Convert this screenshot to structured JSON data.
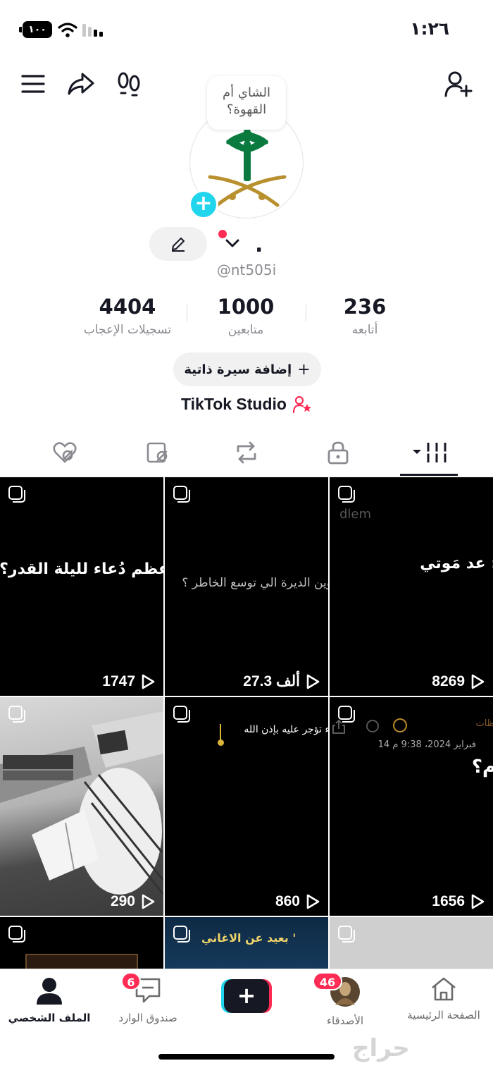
{
  "status_bar": {
    "battery": "١٠٠",
    "time": "١:٢٦"
  },
  "profile": {
    "note_bubble": "الشاي أم القهوة؟",
    "display_name": ".",
    "handle": "@nt505i"
  },
  "stats": [
    {
      "value": "4404",
      "label": "تسجيلات الإعجاب"
    },
    {
      "value": "1000",
      "label": "متابعين"
    },
    {
      "value": "236",
      "label": "أتابعه"
    }
  ],
  "bio_button": {
    "label": "إضافة سيرة ذاتية",
    "plus": "+"
  },
  "studio_link": "TikTok Studio",
  "videos": [
    {
      "caption": "عظم دُعاء لليلة القدر؟",
      "views": "1747"
    },
    {
      "caption": "وين الديرة الي توسع الخاطر ؟",
      "views": "27.3 ألف"
    },
    {
      "caption": "عد مَوتي :",
      "overlay": "dlem",
      "views": "8269"
    },
    {
      "caption": "",
      "views": "290"
    },
    {
      "caption": "ء تؤجر عليه بإذن الله",
      "views": "860"
    },
    {
      "caption": "م؟",
      "overlay": "14 فبراير 2024، 9:38 م",
      "overlay2": "ظات",
      "views": "1656"
    },
    {
      "caption": "",
      "views": ""
    },
    {
      "caption": "بعيد عن الاغاني '",
      "views": ""
    },
    {
      "caption": "",
      "views": ""
    }
  ],
  "bottom_nav": {
    "home": "الصفحة الرئيسية",
    "friends": "الأصدقاء",
    "friends_badge": "46",
    "create": "+",
    "inbox": "صندوق الوارد",
    "inbox_badge": "6",
    "profile": "الملف الشخصي"
  },
  "watermark": "حراج",
  "colors": {
    "accent": "#fe2c55",
    "cyan": "#20d5ec",
    "text": "#161823",
    "muted": "#8a8b91"
  }
}
